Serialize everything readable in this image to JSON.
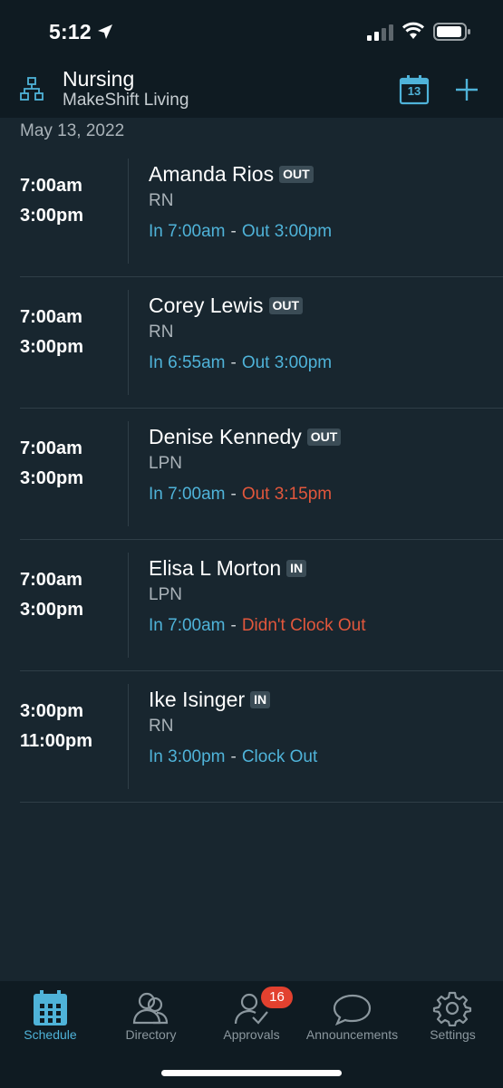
{
  "status_bar": {
    "time": "5:12"
  },
  "header": {
    "title": "Nursing",
    "subtitle": "MakeShift Living",
    "calendar_day": "13"
  },
  "date_label": "May 13, 2022",
  "shifts": [
    {
      "start": "7:00am",
      "end": "3:00pm",
      "name": "Amanda Rios",
      "badge": "OUT",
      "role": "RN",
      "in": "In 7:00am",
      "out": "Out 3:00pm",
      "out_alert": false
    },
    {
      "start": "7:00am",
      "end": "3:00pm",
      "name": "Corey Lewis",
      "badge": "OUT",
      "role": "RN",
      "in": "In 6:55am",
      "out": "Out 3:00pm",
      "out_alert": false
    },
    {
      "start": "7:00am",
      "end": "3:00pm",
      "name": "Denise Kennedy",
      "badge": "OUT",
      "role": "LPN",
      "in": "In 7:00am",
      "out": "Out 3:15pm",
      "out_alert": true
    },
    {
      "start": "7:00am",
      "end": "3:00pm",
      "name": "Elisa L Morton",
      "badge": "IN",
      "role": "LPN",
      "in": "In 7:00am",
      "out": "Didn't Clock Out",
      "out_alert": true
    },
    {
      "start": "3:00pm",
      "end": "11:00pm",
      "name": "Ike Isinger",
      "badge": "IN",
      "role": "RN",
      "in": "In 3:00pm",
      "out": "Clock Out",
      "out_alert": false
    }
  ],
  "separator": "-",
  "tabs": [
    {
      "label": "Schedule",
      "icon": "calendar-icon",
      "active": true
    },
    {
      "label": "Directory",
      "icon": "people-icon",
      "active": false
    },
    {
      "label": "Approvals",
      "icon": "user-check-icon",
      "active": false
    },
    {
      "label": "Announcements",
      "icon": "chat-bubble-icon",
      "active": false
    },
    {
      "label": "Settings",
      "icon": "gear-icon",
      "active": false
    }
  ],
  "approvals_badge": "16",
  "colors": {
    "accent": "#4fb3d9",
    "alert": "#e2573c",
    "background": "#18262f",
    "bar": "#0f1b22"
  }
}
